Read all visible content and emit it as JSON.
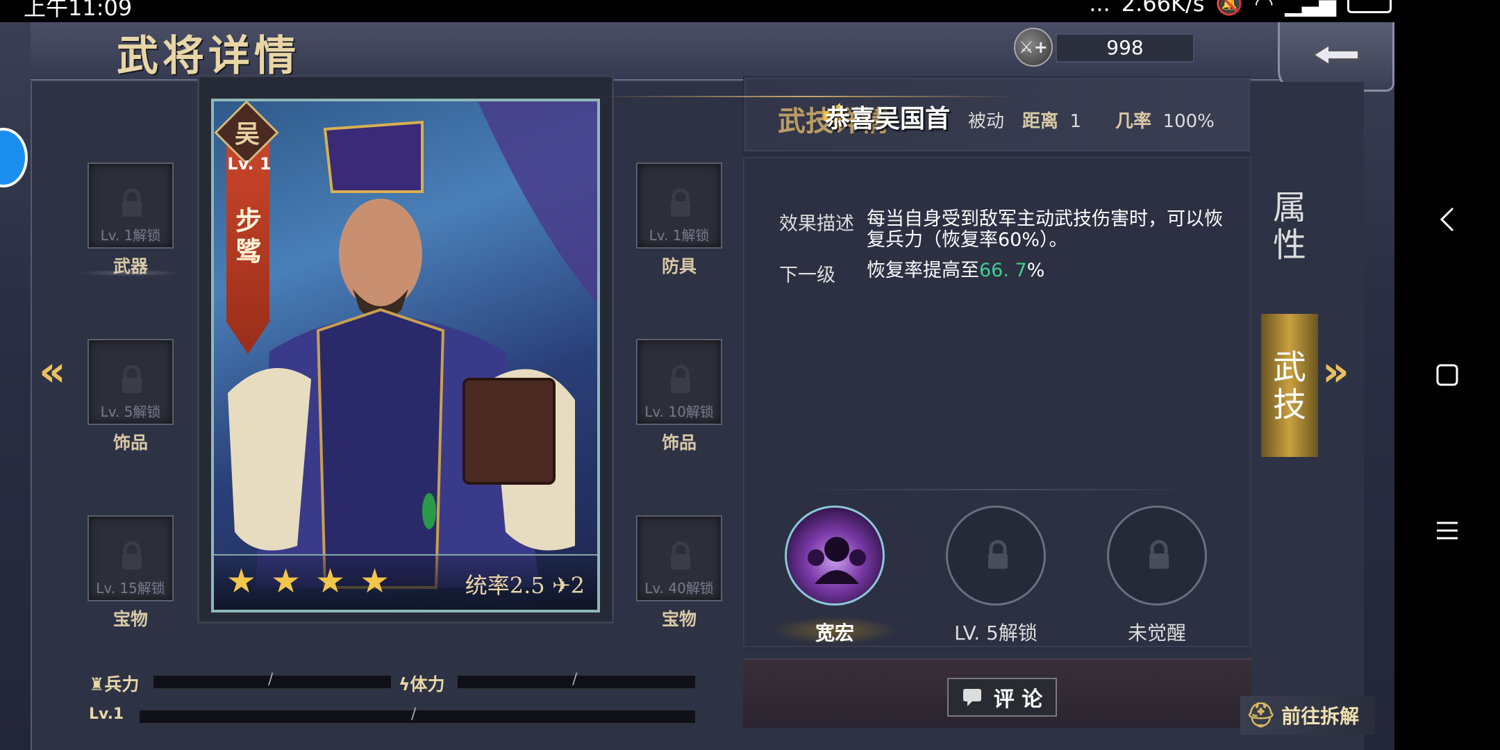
{
  "status": {
    "time": "上午11:09",
    "net_speed": "2.66K/s",
    "dots": "..."
  },
  "header": {
    "title": "武将详情",
    "currency_amount": "998"
  },
  "slots": {
    "left": [
      {
        "label": "武器",
        "unlock": "Lv. 1解锁"
      },
      {
        "label": "饰品",
        "unlock": "Lv. 5解锁"
      },
      {
        "label": "宝物",
        "unlock": "Lv. 15解锁"
      }
    ],
    "right": [
      {
        "label": "防具",
        "unlock": "Lv. 1解锁"
      },
      {
        "label": "饰品",
        "unlock": "Lv. 10解锁"
      },
      {
        "label": "宝物",
        "unlock": "Lv. 40解锁"
      }
    ]
  },
  "card": {
    "faction": "吴",
    "level": "Lv. 1",
    "name": "步骘",
    "stars": 4,
    "command": "统率2.5",
    "move": "2"
  },
  "skill": {
    "tab": "武技详情",
    "type": "被动",
    "distance_label": "距离",
    "distance": "1",
    "rate_label": "几率",
    "rate": "100%",
    "notice": "恭喜吴国首",
    "effect_label": "效果描述",
    "effect_line1": "每当自身受到敌军主动武技伤害时，可以恢",
    "effect_line2": "复兵力（恢复率60%）。",
    "next_label": "下一级",
    "next_prefix": "恢复率提高至",
    "next_value": "66. 7",
    "next_suffix": "%",
    "skills": [
      {
        "label": "宽宏"
      },
      {
        "label": "LV. 5解锁"
      },
      {
        "label": "未觉醒"
      }
    ]
  },
  "tabs": {
    "attributes": "属性",
    "skills": "武技"
  },
  "bottom": {
    "troops_label": "兵力",
    "stamina_label": "体力",
    "level_label": "Lv.1",
    "slash": "/",
    "comment": "评 论",
    "disassemble": "前往拆解"
  },
  "colors": {
    "accent": "#e8c060",
    "highlight": "#3ecf8e",
    "title": "#e8d6a6"
  }
}
